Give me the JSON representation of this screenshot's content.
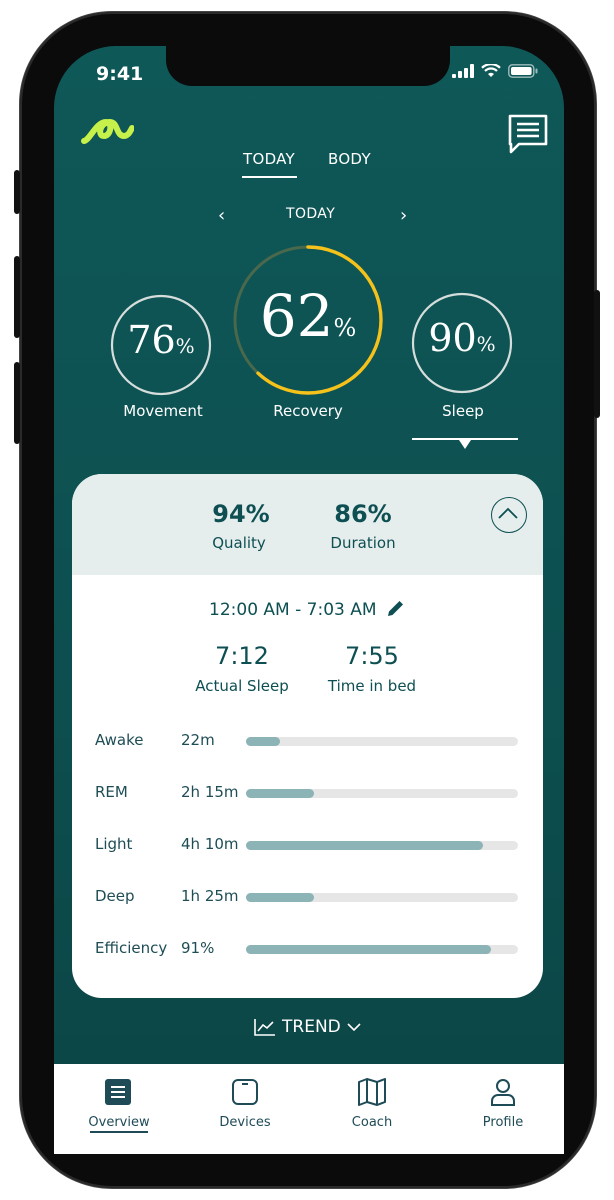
{
  "status": {
    "time": "9:41"
  },
  "tabs": {
    "today": "TODAY",
    "body": "BODY"
  },
  "date_nav": {
    "label": "TODAY",
    "prev": "‹",
    "next": "›"
  },
  "rings": {
    "movement": {
      "value": "76",
      "unit": "%",
      "label": "Movement",
      "fraction": 1.0
    },
    "recovery": {
      "value": "62",
      "unit": "%",
      "label": "Recovery",
      "fraction": 0.62
    },
    "sleep": {
      "value": "90",
      "unit": "%",
      "label": "Sleep",
      "fraction": 1.0
    }
  },
  "card": {
    "quality": {
      "value": "94%",
      "label": "Quality"
    },
    "duration": {
      "value": "86%",
      "label": "Duration"
    },
    "time_range": "12:00 AM - 7:03 AM",
    "actual_sleep": {
      "value": "7:12",
      "label": "Actual Sleep"
    },
    "time_in_bed": {
      "value": "7:55",
      "label": "Time in bed"
    },
    "stages": [
      {
        "name": "Awake",
        "value": "22m",
        "fraction": 0.125
      },
      {
        "name": "REM",
        "value": "2h 15m",
        "fraction": 0.25
      },
      {
        "name": "Light",
        "value": "4h 10m",
        "fraction": 0.87
      },
      {
        "name": "Deep",
        "value": "1h 25m",
        "fraction": 0.25
      },
      {
        "name": "Efficiency",
        "value": "91%",
        "fraction": 0.9
      }
    ]
  },
  "trend": {
    "label": "TREND"
  },
  "tabbar": {
    "overview": "Overview",
    "devices": "Devices",
    "coach": "Coach",
    "profile": "Profile"
  },
  "colors": {
    "background": "#0d4f50",
    "accent": "#f5c21b",
    "logo": "#c6f04a",
    "text_dark": "#0d4f52",
    "bar_fill": "#8cb3b5"
  }
}
